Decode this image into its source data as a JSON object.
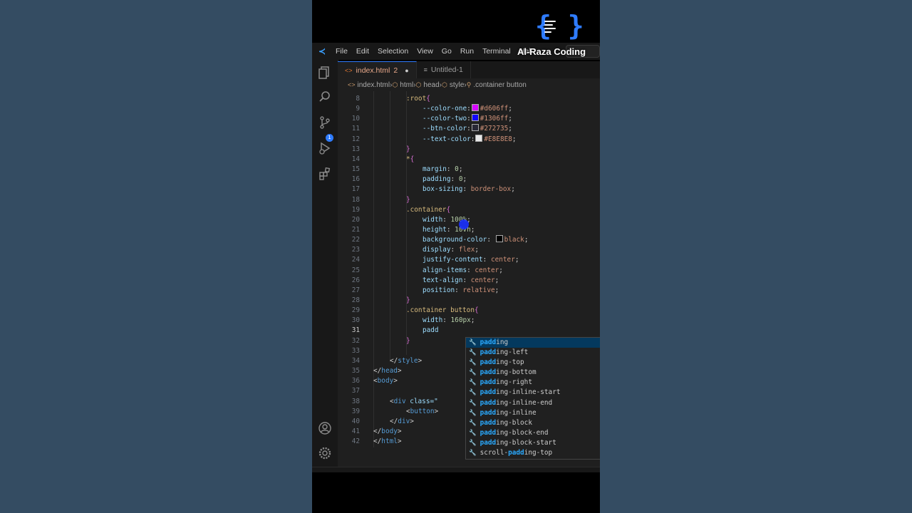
{
  "brand": {
    "name": "Al-Raza Coding"
  },
  "menu": [
    "File",
    "Edit",
    "Selection",
    "View",
    "Go",
    "Run",
    "Terminal",
    "Hel"
  ],
  "tabs": [
    {
      "label": "index.html",
      "count": "2",
      "modified": "●",
      "active": true
    },
    {
      "label": "Untitled-1",
      "active": false
    }
  ],
  "breadcrumb": [
    "index.html",
    "html",
    "head",
    "style",
    ".container button"
  ],
  "activity_icons": [
    "files-icon",
    "search-icon",
    "source-control-icon",
    "run-debug-icon",
    "extensions-icon",
    "account-icon",
    "settings-gear-icon"
  ],
  "activity_badge": "1",
  "editor": {
    "current_line": 31,
    "lines": [
      {
        "n": "8",
        "indent": 2,
        "parts": [
          [
            ":root",
            "c-sel"
          ],
          [
            "{",
            "c-bra"
          ]
        ]
      },
      {
        "n": "9",
        "indent": 3,
        "parts": [
          [
            "--color-one",
            "c-prop"
          ],
          [
            ":",
            "c-pun"
          ],
          [
            "SW#d606ff",
            ""
          ],
          [
            "#d606ff",
            "c-txt"
          ],
          [
            ";",
            "c-pun"
          ]
        ]
      },
      {
        "n": "10",
        "indent": 3,
        "parts": [
          [
            "--color-two",
            "c-prop"
          ],
          [
            ":",
            "c-pun"
          ],
          [
            "SW#1306ff",
            ""
          ],
          [
            "#1306ff",
            "c-txt"
          ],
          [
            ";",
            "c-pun"
          ]
        ]
      },
      {
        "n": "11",
        "indent": 3,
        "parts": [
          [
            "--btn-color",
            "c-prop"
          ],
          [
            ":",
            "c-pun"
          ],
          [
            "SW#272735",
            ""
          ],
          [
            "#272735",
            "c-txt"
          ],
          [
            ";",
            "c-pun"
          ]
        ]
      },
      {
        "n": "12",
        "indent": 3,
        "parts": [
          [
            "--text-color",
            "c-prop"
          ],
          [
            ":",
            "c-pun"
          ],
          [
            "SW#E8E8E8",
            ""
          ],
          [
            "#E8E8E8",
            "c-txt"
          ],
          [
            ";",
            "c-pun"
          ]
        ]
      },
      {
        "n": "13",
        "indent": 2,
        "parts": [
          [
            "}",
            "c-bra"
          ]
        ]
      },
      {
        "n": "14",
        "indent": 2,
        "parts": [
          [
            "*",
            "c-sel"
          ],
          [
            "{",
            "c-bra"
          ]
        ]
      },
      {
        "n": "15",
        "indent": 3,
        "parts": [
          [
            "margin",
            "c-prop"
          ],
          [
            ": ",
            "c-pun"
          ],
          [
            "0",
            "c-num"
          ],
          [
            ";",
            "c-pun"
          ]
        ]
      },
      {
        "n": "16",
        "indent": 3,
        "parts": [
          [
            "padding",
            "c-prop"
          ],
          [
            ": ",
            "c-pun"
          ],
          [
            "0",
            "c-num"
          ],
          [
            ";",
            "c-pun"
          ]
        ]
      },
      {
        "n": "17",
        "indent": 3,
        "parts": [
          [
            "box-sizing",
            "c-prop"
          ],
          [
            ": ",
            "c-pun"
          ],
          [
            "border-box",
            "c-txt"
          ],
          [
            ";",
            "c-pun"
          ]
        ]
      },
      {
        "n": "18",
        "indent": 2,
        "parts": [
          [
            "}",
            "c-bra"
          ]
        ]
      },
      {
        "n": "19",
        "indent": 2,
        "parts": [
          [
            ".container",
            "c-sel"
          ],
          [
            "{",
            "c-bra"
          ]
        ]
      },
      {
        "n": "20",
        "indent": 3,
        "parts": [
          [
            "width",
            "c-prop"
          ],
          [
            ": ",
            "c-pun"
          ],
          [
            "100",
            "c-num"
          ],
          [
            "%",
            "c-unit"
          ],
          [
            ";",
            "c-pun"
          ]
        ]
      },
      {
        "n": "21",
        "indent": 3,
        "parts": [
          [
            "height",
            "c-prop"
          ],
          [
            ": ",
            "c-pun"
          ],
          [
            "10",
            "c-num"
          ],
          [
            "vh",
            "c-unit"
          ],
          [
            ";",
            "c-pun"
          ]
        ]
      },
      {
        "n": "22",
        "indent": 3,
        "parts": [
          [
            "background-color",
            "c-prop"
          ],
          [
            ": ",
            "c-pun"
          ],
          [
            "SW#000000",
            ""
          ],
          [
            "black",
            "c-txt"
          ],
          [
            ";",
            "c-pun"
          ]
        ]
      },
      {
        "n": "23",
        "indent": 3,
        "parts": [
          [
            "display",
            "c-prop"
          ],
          [
            ": ",
            "c-pun"
          ],
          [
            "flex",
            "c-txt"
          ],
          [
            ";",
            "c-pun"
          ]
        ]
      },
      {
        "n": "24",
        "indent": 3,
        "parts": [
          [
            "justify-content",
            "c-prop"
          ],
          [
            ": ",
            "c-pun"
          ],
          [
            "center",
            "c-txt"
          ],
          [
            ";",
            "c-pun"
          ]
        ]
      },
      {
        "n": "25",
        "indent": 3,
        "parts": [
          [
            "align-items",
            "c-prop"
          ],
          [
            ": ",
            "c-pun"
          ],
          [
            "center",
            "c-txt"
          ],
          [
            ";",
            "c-pun"
          ]
        ]
      },
      {
        "n": "26",
        "indent": 3,
        "parts": [
          [
            "text-align",
            "c-prop"
          ],
          [
            ": ",
            "c-pun"
          ],
          [
            "center",
            "c-txt"
          ],
          [
            ";",
            "c-pun"
          ]
        ]
      },
      {
        "n": "27",
        "indent": 3,
        "parts": [
          [
            "position",
            "c-prop"
          ],
          [
            ": ",
            "c-pun"
          ],
          [
            "relative",
            "c-txt"
          ],
          [
            ";",
            "c-pun"
          ]
        ]
      },
      {
        "n": "28",
        "indent": 2,
        "parts": [
          [
            "}",
            "c-bra"
          ]
        ]
      },
      {
        "n": "29",
        "indent": 2,
        "parts": [
          [
            ".container ",
            "c-sel"
          ],
          [
            "button",
            "c-sel"
          ],
          [
            "{",
            "c-bra"
          ]
        ]
      },
      {
        "n": "30",
        "indent": 3,
        "parts": [
          [
            "width",
            "c-prop"
          ],
          [
            ": ",
            "c-pun"
          ],
          [
            "160",
            "c-num"
          ],
          [
            "px",
            "c-unit"
          ],
          [
            ";",
            "c-pun"
          ]
        ]
      },
      {
        "n": "31",
        "indent": 3,
        "parts": [
          [
            "padd",
            "c-prop"
          ]
        ]
      },
      {
        "n": "32",
        "indent": 2,
        "parts": [
          [
            "}",
            "c-bra"
          ]
        ]
      },
      {
        "n": "33",
        "indent": 0,
        "parts": []
      },
      {
        "n": "34",
        "indent": 1,
        "parts": [
          [
            "</",
            "c-pun"
          ],
          [
            "style",
            "c-tag"
          ],
          [
            ">",
            "c-pun"
          ]
        ]
      },
      {
        "n": "35",
        "indent": 0,
        "parts": [
          [
            "</",
            "c-pun"
          ],
          [
            "head",
            "c-tag"
          ],
          [
            ">",
            "c-pun"
          ]
        ]
      },
      {
        "n": "36",
        "indent": 0,
        "parts": [
          [
            "<",
            "c-pun"
          ],
          [
            "body",
            "c-tag"
          ],
          [
            ">",
            "c-pun"
          ]
        ]
      },
      {
        "n": "37",
        "indent": 0,
        "parts": []
      },
      {
        "n": "38",
        "indent": 1,
        "parts": [
          [
            "<",
            "c-pun"
          ],
          [
            "div",
            "c-tag"
          ],
          [
            " class=\"",
            "c-prop"
          ]
        ]
      },
      {
        "n": "39",
        "indent": 2,
        "parts": [
          [
            "<",
            "c-pun"
          ],
          [
            "button",
            "c-tag"
          ],
          [
            ">",
            "c-pun"
          ]
        ]
      },
      {
        "n": "40",
        "indent": 1,
        "parts": [
          [
            "</",
            "c-pun"
          ],
          [
            "div",
            "c-tag"
          ],
          [
            ">",
            "c-pun"
          ]
        ]
      },
      {
        "n": "41",
        "indent": 0,
        "parts": [
          [
            "</",
            "c-pun"
          ],
          [
            "body",
            "c-tag"
          ],
          [
            ">",
            "c-pun"
          ]
        ]
      },
      {
        "n": "42",
        "indent": 0,
        "parts": [
          [
            "</",
            "c-pun"
          ],
          [
            "html",
            "c-tag"
          ],
          [
            ">",
            "c-pun"
          ]
        ]
      }
    ]
  },
  "suggestions": {
    "typed": "padd",
    "items": [
      {
        "pre": "",
        "match": "padd",
        "post": "ing"
      },
      {
        "pre": "",
        "match": "padd",
        "post": "ing-left"
      },
      {
        "pre": "",
        "match": "padd",
        "post": "ing-top"
      },
      {
        "pre": "",
        "match": "padd",
        "post": "ing-bottom"
      },
      {
        "pre": "",
        "match": "padd",
        "post": "ing-right"
      },
      {
        "pre": "",
        "match": "padd",
        "post": "ing-inline-start"
      },
      {
        "pre": "",
        "match": "padd",
        "post": "ing-inline-end"
      },
      {
        "pre": "",
        "match": "padd",
        "post": "ing-inline"
      },
      {
        "pre": "",
        "match": "padd",
        "post": "ing-block"
      },
      {
        "pre": "",
        "match": "padd",
        "post": "ing-block-end"
      },
      {
        "pre": "",
        "match": "padd",
        "post": "ing-block-start"
      },
      {
        "pre": "scroll-",
        "match": "padd",
        "post": "ing-top"
      }
    ]
  },
  "colors": {
    "accent": "#2f7cff",
    "editor_bg": "#1f1f1f",
    "page_bg": "#344c62"
  }
}
